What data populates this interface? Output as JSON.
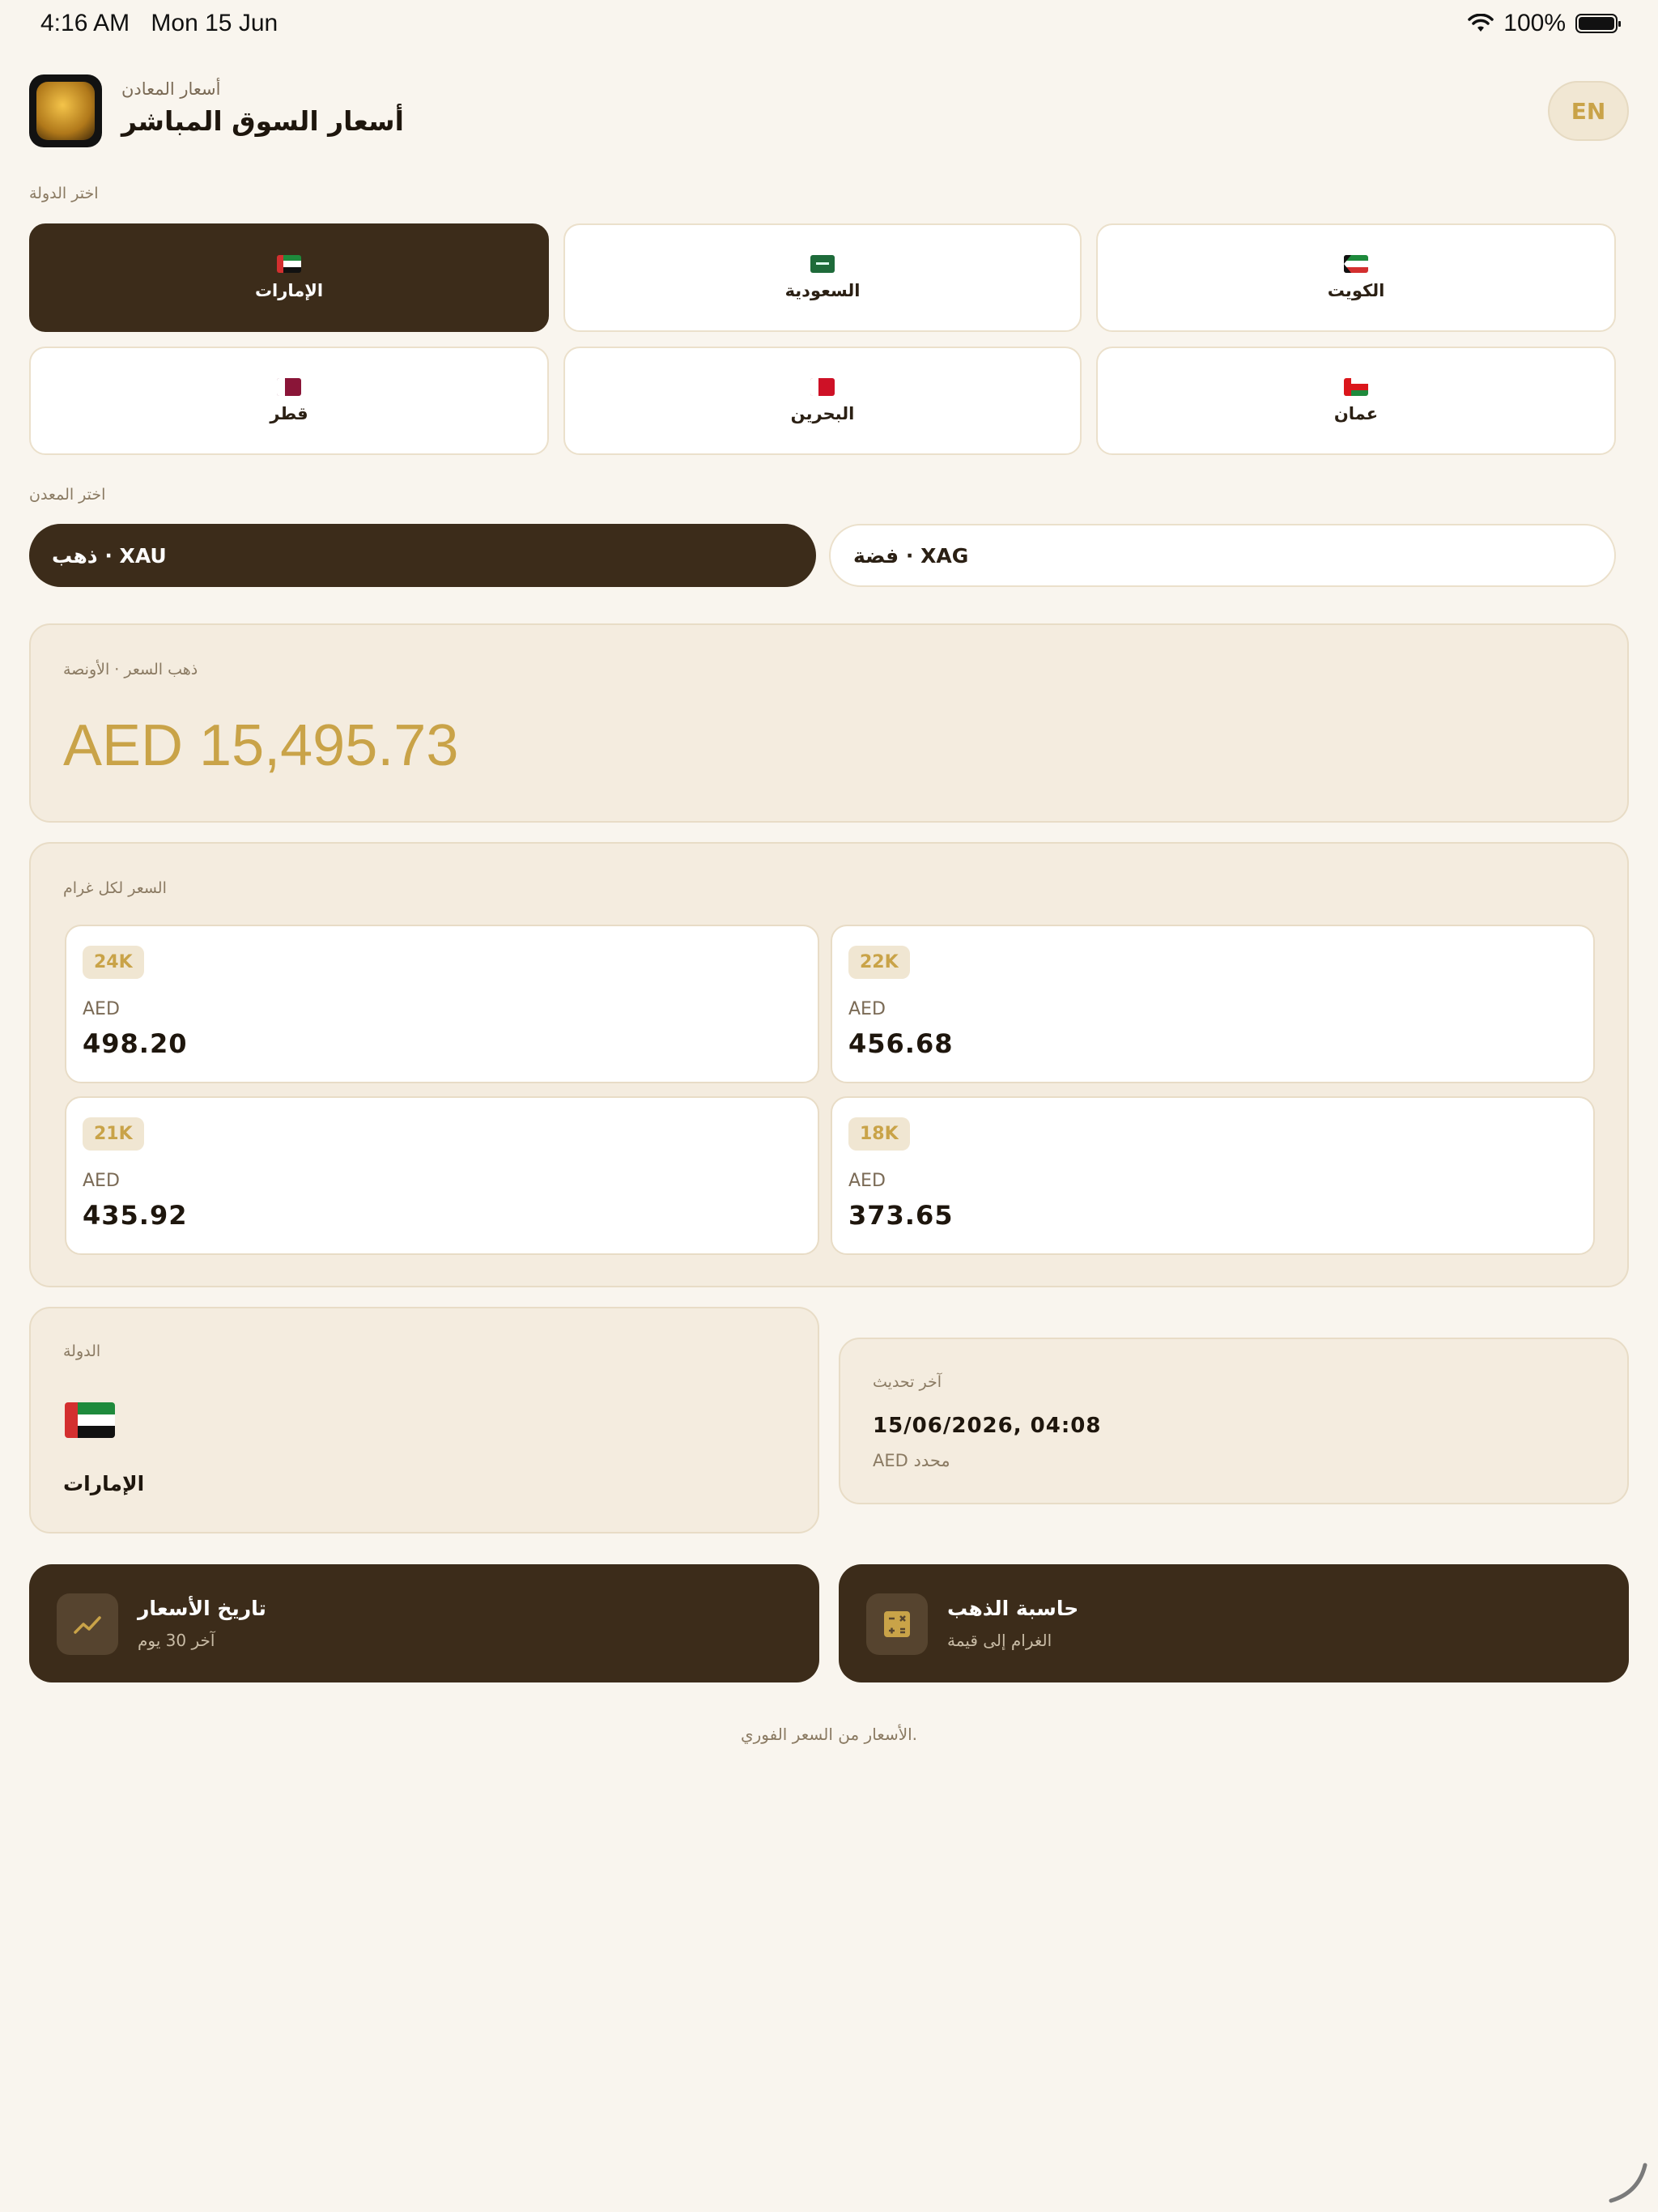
{
  "status_bar": {
    "time": "4:16 AM",
    "date": "Mon 15 Jun",
    "battery": "100%"
  },
  "header": {
    "subtitle": "أسعار المعادن",
    "title": "أسعار السوق المباشر",
    "lang_button": "EN"
  },
  "country_section": {
    "label": "اختر الدولة",
    "countries": [
      {
        "name": "الإمارات",
        "flag": "uae-flag",
        "selected": true
      },
      {
        "name": "السعودية",
        "flag": "saudi-flag",
        "selected": false
      },
      {
        "name": "الكويت",
        "flag": "kuwait-flag",
        "selected": false
      },
      {
        "name": "قطر",
        "flag": "qatar-flag",
        "selected": false
      },
      {
        "name": "البحرين",
        "flag": "bahrain-flag",
        "selected": false
      },
      {
        "name": "عمان",
        "flag": "oman-flag",
        "selected": false
      }
    ]
  },
  "metal_section": {
    "label": "اختر المعدن",
    "metals": [
      {
        "label": "ذهب · XAU",
        "selected": true
      },
      {
        "label": "فضة · XAG",
        "selected": false
      }
    ]
  },
  "ounce_card": {
    "label": "ذهب السعر · الأونصة",
    "price": "AED 15,495.73"
  },
  "gram_card": {
    "label": "السعر لكل غرام",
    "items": [
      {
        "karat": "24K",
        "currency": "AED",
        "value": "498.20"
      },
      {
        "karat": "22K",
        "currency": "AED",
        "value": "456.68"
      },
      {
        "karat": "21K",
        "currency": "AED",
        "value": "435.92"
      },
      {
        "karat": "18K",
        "currency": "AED",
        "value": "373.65"
      }
    ]
  },
  "country_card": {
    "label": "الدولة",
    "name": "الإمارات"
  },
  "update_card": {
    "label": "آخر تحديث",
    "timestamp": "15/06/2026, 04:08",
    "note": "AED محدد"
  },
  "actions": {
    "history": {
      "title": "تاريخ الأسعار",
      "subtitle": "آخر 30 يوم",
      "icon": "trend-chart-icon"
    },
    "calculator": {
      "title": "حاسبة الذهب",
      "subtitle": "الغرام إلى قيمة",
      "icon": "calculator-icon"
    }
  },
  "footer": {
    "note": "الأسعار من السعر الفوري."
  },
  "colors": {
    "background": "#f9f5ee",
    "dark_brown": "#3c2c1a",
    "gold": "#c9a348",
    "card": "#f4ecdf"
  }
}
